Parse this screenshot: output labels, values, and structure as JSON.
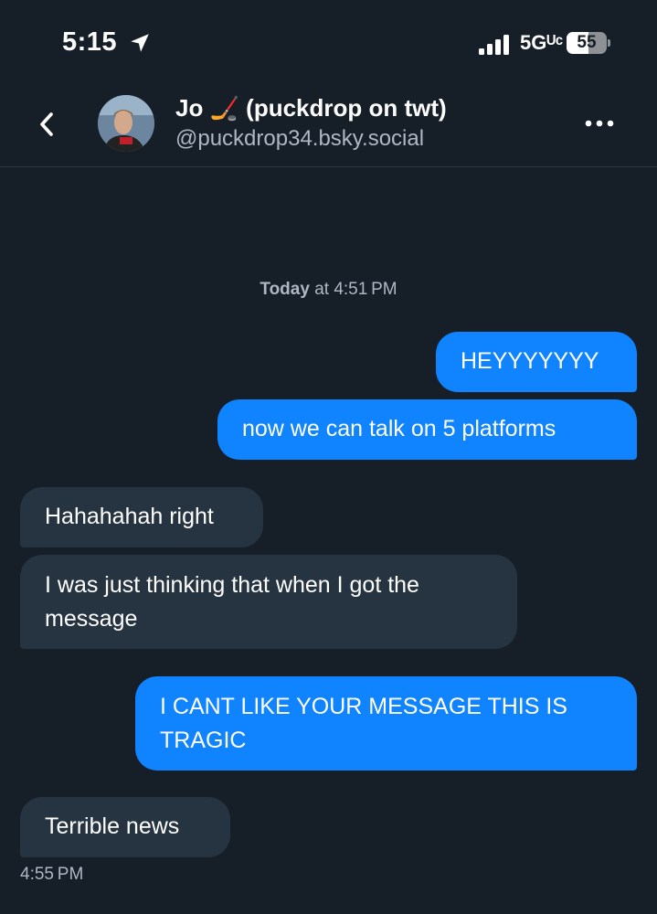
{
  "status_bar": {
    "time": "5:15",
    "network": "5Gᵁᶜ",
    "battery_level": "55",
    "battery_fraction": 0.55
  },
  "header": {
    "back_icon": "chevron-left-icon",
    "contact_name": "Jo 🏒 (puckdrop on twt)",
    "contact_handle": "@puckdrop34.bsky.social",
    "more_icon": "ellipsis-icon"
  },
  "conversation": {
    "date_divider_bold": "Today",
    "date_divider_rest": " at 4:51 PM",
    "messages": [
      {
        "direction": "out",
        "text": "HEYYYYYYY"
      },
      {
        "direction": "out",
        "text": "now we can talk on 5 platforms"
      },
      {
        "direction": "in",
        "text": "Hahahahah right"
      },
      {
        "direction": "in",
        "text": "I was just thinking that when I got the message"
      },
      {
        "direction": "out",
        "text": "I CANT LIKE YOUR MESSAGE THIS IS TRAGIC"
      },
      {
        "direction": "in",
        "text": "Terrible news"
      }
    ],
    "last_message_time": "4:55 PM"
  },
  "colors": {
    "background": "#161e27",
    "outgoing_bubble": "#1083fe",
    "incoming_bubble": "#263340",
    "secondary_text": "#aeb7c3"
  }
}
